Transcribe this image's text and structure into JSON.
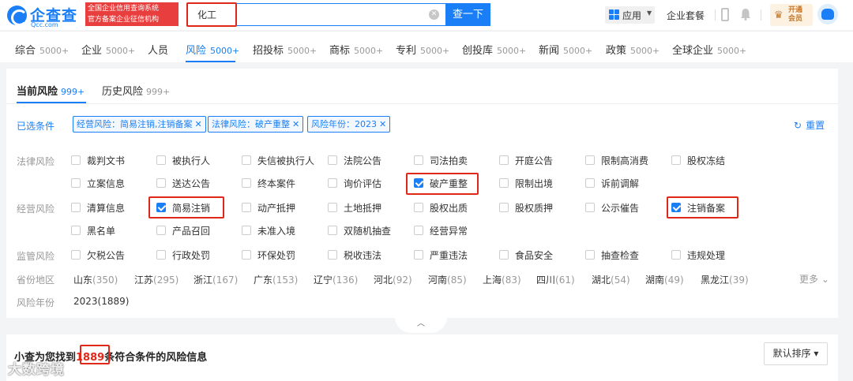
{
  "header": {
    "logo_text": "企查查",
    "logo_domain": "Qcc.com",
    "slogan_line1": "全国企业信用查询系统",
    "slogan_line2": "官方备案企业征信机构",
    "search_value": "化工",
    "search_button": "查一下",
    "apps_label": "应用",
    "suite_label": "企业套餐",
    "vip_line1": "开通",
    "vip_line2": "会员"
  },
  "tabs": [
    {
      "label": "综合",
      "count": "5000+"
    },
    {
      "label": "企业",
      "count": "5000+"
    },
    {
      "label": "人员",
      "count": ""
    },
    {
      "label": "风险",
      "count": "5000+",
      "active": true
    },
    {
      "label": "招投标",
      "count": "5000+"
    },
    {
      "label": "商标",
      "count": "5000+"
    },
    {
      "label": "专利",
      "count": "5000+"
    },
    {
      "label": "创投库",
      "count": "5000+"
    },
    {
      "label": "新闻",
      "count": "5000+"
    },
    {
      "label": "政策",
      "count": "5000+"
    },
    {
      "label": "全球企业",
      "count": "5000+"
    }
  ],
  "subtabs": [
    {
      "label": "当前风险",
      "count": "999+",
      "active": true
    },
    {
      "label": "历史风险",
      "count": "999+"
    }
  ],
  "selected": {
    "label": "已选条件",
    "chips": [
      "经营风险：简易注销,注销备案",
      "法律风险：破产重整",
      "风险年份：2023"
    ],
    "reset": "重置"
  },
  "filters": {
    "legal_label": "法律风险",
    "legal_row1": [
      "裁判文书",
      "被执行人",
      "失信被执行人",
      "法院公告",
      "司法拍卖",
      "开庭公告",
      "限制高消费",
      "股权冻结"
    ],
    "legal_row2": [
      "立案信息",
      "送达公告",
      "终本案件",
      "询价评估",
      "破产重整",
      "限制出境",
      "诉前调解"
    ],
    "biz_label": "经营风险",
    "biz_row1": [
      "清算信息",
      "简易注销",
      "动产抵押",
      "土地抵押",
      "股权出质",
      "股权质押",
      "公示催告",
      "注销备案"
    ],
    "biz_row2": [
      "黑名单",
      "产品召回",
      "未准入境",
      "双随机抽查",
      "经营异常"
    ],
    "reg_label": "监管风险",
    "reg_row": [
      "欠税公告",
      "行政处罚",
      "环保处罚",
      "税收违法",
      "严重违法",
      "食品安全",
      "抽查检查",
      "违规处理"
    ],
    "province_label": "省份地区",
    "provinces": [
      {
        "name": "山东",
        "count": "(350)"
      },
      {
        "name": "江苏",
        "count": "(295)"
      },
      {
        "name": "浙江",
        "count": "(167)"
      },
      {
        "name": "广东",
        "count": "(153)"
      },
      {
        "name": "辽宁",
        "count": "(136)"
      },
      {
        "name": "河北",
        "count": "(92)"
      },
      {
        "name": "河南",
        "count": "(85)"
      },
      {
        "name": "上海",
        "count": "(83)"
      },
      {
        "name": "四川",
        "count": "(61)"
      },
      {
        "name": "湖北",
        "count": "(54)"
      },
      {
        "name": "湖南",
        "count": "(49)"
      },
      {
        "name": "黑龙江",
        "count": "(39)"
      }
    ],
    "more": "更多",
    "year_label": "风险年份",
    "year_value": "2023(1889)"
  },
  "results": {
    "prefix": "小查为您找到",
    "count": "1889",
    "suffix": "条符合条件的风险信息",
    "sort": "默认排序"
  },
  "watermark": "大数跨境",
  "colors": {
    "accent": "#1a7ff6",
    "highlight": "#e0281a"
  }
}
